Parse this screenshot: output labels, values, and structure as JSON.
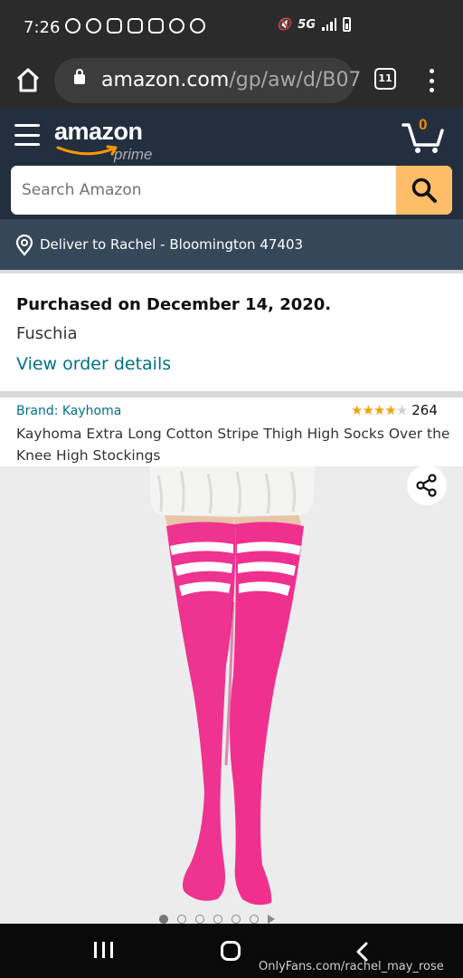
{
  "status_bar": {
    "time": "7:26",
    "network": "5G"
  },
  "browser": {
    "url_domain": "amazon.com",
    "url_path": "/gp/aw/d/B07",
    "tab_count": "11"
  },
  "header": {
    "logo_text": "amazon",
    "logo_sub": "prime",
    "cart_count": "0",
    "search_placeholder": "Search Amazon"
  },
  "deliver": {
    "text": "Deliver to Rachel - Bloomington 47403"
  },
  "purchase": {
    "date_text": "Purchased on December 14, 2020.",
    "variant": "Fuschia",
    "link_text": "View order details"
  },
  "product": {
    "brand": "Brand: Kayhoma",
    "rating": 4,
    "rating_max": 5,
    "review_count": "264",
    "title": "Kayhoma Extra Long Cotton Stripe Thigh High Socks Over the Knee High Stockings",
    "image_count": 6,
    "active_image": 0
  },
  "colors": {
    "amazon_dark": "#232f3e",
    "amazon_blue_gray": "#37475a",
    "amazon_orange": "#febd69",
    "link_teal": "#007185",
    "sock_pink": "#f0308e",
    "star_gold": "#f0a20c"
  },
  "icons": [
    "home-icon",
    "lock-icon",
    "tabs-icon",
    "more-vert-icon",
    "hamburger-icon",
    "cart-icon",
    "search-icon",
    "location-pin-icon",
    "share-icon"
  ],
  "watermark": "OnlyFans.com/rachel_may_rose"
}
